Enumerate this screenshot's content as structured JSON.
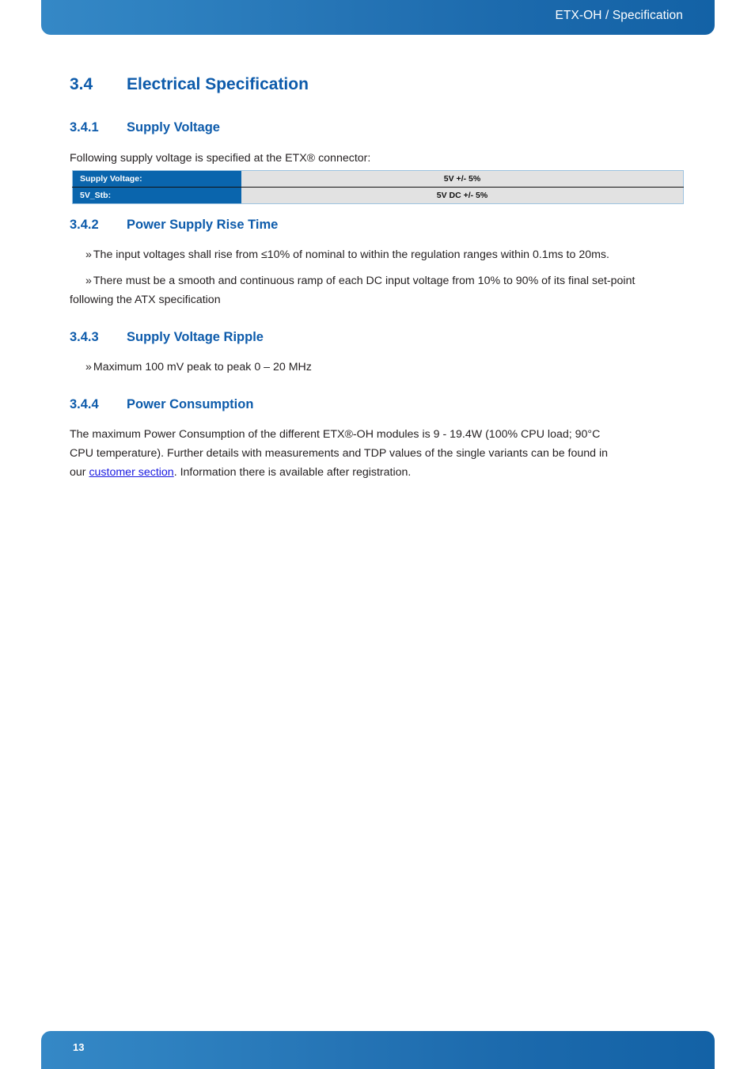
{
  "header": {
    "title": "ETX-OH / Specification"
  },
  "document": {
    "section": {
      "number": "3.4",
      "title": "Electrical Specification"
    },
    "subsections": [
      {
        "number": "3.4.1",
        "title": "Supply Voltage",
        "intro": "Following supply voltage is specified at the ETX® connector:",
        "table": {
          "rows": [
            {
              "label": "Supply Voltage:",
              "value": "5V +/- 5%"
            },
            {
              "label": "5V_Stb:",
              "value": "5V DC +/- 5%"
            }
          ]
        }
      },
      {
        "number": "3.4.2",
        "title": "Power Supply Rise Time",
        "bullets": [
          {
            "marker": "»",
            "text": "The input voltages shall rise from ≤10% of nominal to within the regulation ranges within 0.1ms to 20ms."
          },
          {
            "marker": "»",
            "text": "There must be a smooth and continuous ramp of each DC input voltage from 10% to 90% of its final set-point",
            "continuation": "following the ATX specification"
          }
        ]
      },
      {
        "number": "3.4.3",
        "title": "Supply Voltage Ripple",
        "bullets": [
          {
            "marker": "»",
            "text": "Maximum 100 mV peak to peak 0 – 20 MHz"
          }
        ]
      },
      {
        "number": "3.4.4",
        "title": "Power Consumption",
        "paragraph": {
          "before_link": "The maximum Power Consumption of the different ETX®-OH modules is 9 - 19.4W (100% CPU load; 90°C CPU temperature). Further details with measurements and TDP values of the single variants can be found in our ",
          "link_text": "customer section",
          "after_link": ". Information there is available after registration."
        }
      }
    ]
  },
  "footer": {
    "page_number": "13"
  },
  "colors": {
    "heading_blue": "#0d5bab",
    "bar_blue_light": "#3588c6",
    "bar_blue_dark": "#1362a6",
    "table_header_blue": "#0a65ad",
    "table_cell_gray": "#e2e2e2",
    "link_blue": "#1a1ae0"
  }
}
